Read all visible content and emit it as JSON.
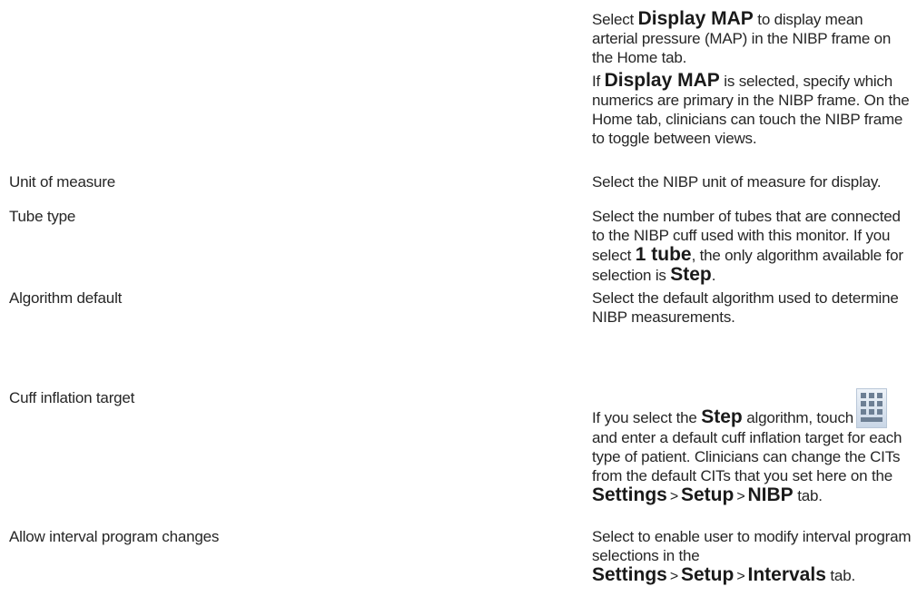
{
  "intro": [
    {
      "pre": "Select ",
      "b1": "Display MAP",
      "post": " to display mean arterial pressure (MAP) in the NIBP frame on the Home tab."
    },
    {
      "pre": "If ",
      "b1": "Display MAP",
      "post": " is selected, specify which numerics are primary in the NIBP frame. On the Home tab, clinicians can touch the NIBP frame to toggle between views."
    }
  ],
  "rows": [
    {
      "label": "Unit of measure",
      "desc": "Select the NIBP unit of measure for display."
    },
    {
      "label": "Tube type",
      "desc_pre": "Select the number of tubes that are connected to the NIBP cuff used with this monitor. If you select ",
      "b1": "1 tube",
      "desc_mid": ", the only algorithm available for selection is ",
      "b2": "Step",
      "desc_post": "."
    },
    {
      "label": "Algorithm default",
      "desc": "Select the default algorithm used to determine NIBP measurements."
    },
    {
      "label": "Cuff inflation target",
      "desc_pre": "If you select the ",
      "b1": "Step",
      "desc_mid": " algorithm, touch",
      "desc_mid2": "and enter a default cuff inflation target for each type of patient. Clinicians can change the CITs from the default CITs that you set here on the ",
      "b2": "Settings",
      "sep1": ">",
      "b3": "Setup",
      "sep2": ">",
      "b4": "NIBP",
      "desc_post": " tab.",
      "icon": "keypad-icon"
    },
    {
      "label": "Allow interval program changes",
      "desc_pre": "Select to enable user to modify interval program selections in the ",
      "b1": "Settings",
      "sep1": ">",
      "b2": "Setup",
      "sep2": ">",
      "b3": "Intervals",
      "desc_post": " tab."
    }
  ]
}
